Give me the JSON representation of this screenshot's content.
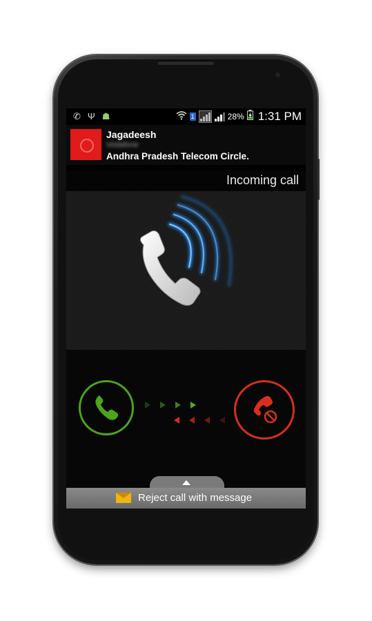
{
  "statusbar": {
    "left_icons": [
      "phone-icon",
      "usb-icon",
      "android-debug-icon"
    ],
    "sim_badge": "1",
    "battery": "28%",
    "time": "1:31 PM"
  },
  "caller": {
    "name": "Jagadeesh",
    "carrier": "Vodafone",
    "circle": "Andhra Pradesh Telecom Circle."
  },
  "call": {
    "status": "Incoming call"
  },
  "actions": {
    "reject_with_message": "Reject call with message"
  },
  "colors": {
    "answer": "#4ca51d",
    "reject": "#d92e1c",
    "glow": "#1e8fff",
    "caller_photo": "#e21a1a"
  }
}
